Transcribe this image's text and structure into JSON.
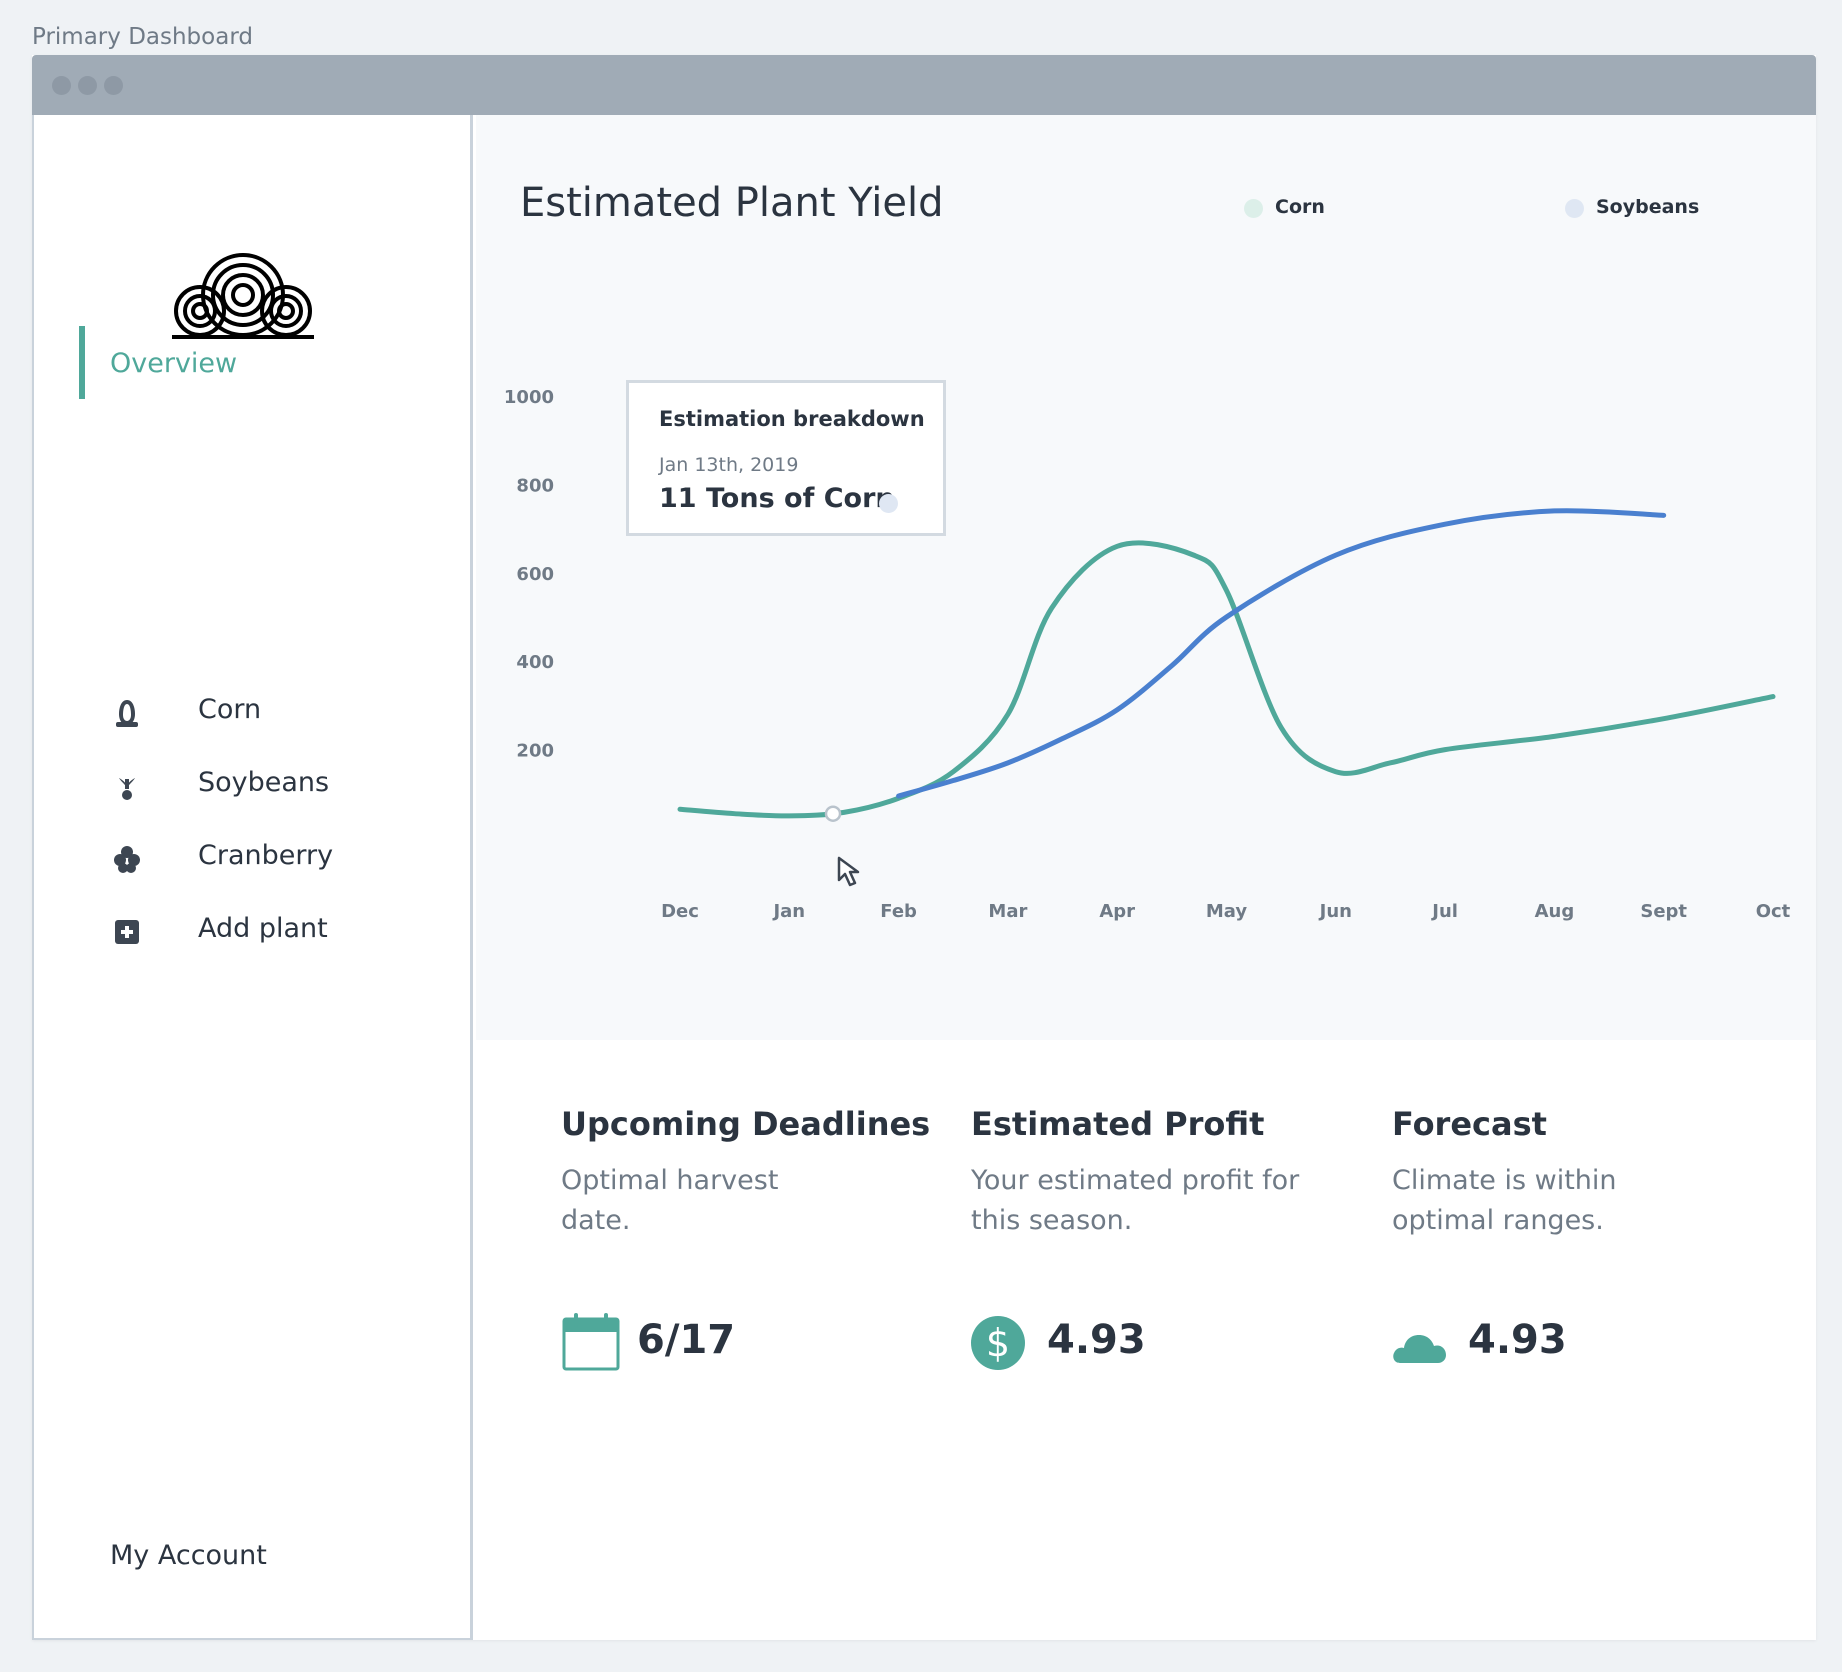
{
  "page_caption": "Primary Dashboard",
  "sidebar": {
    "logo": "swirl-cloud-logo",
    "overview": "Overview",
    "items": [
      {
        "label": "Corn",
        "icon": "corn-icon"
      },
      {
        "label": "Soybeans",
        "icon": "soybean-icon"
      },
      {
        "label": "Cranberry",
        "icon": "cranberry-icon"
      },
      {
        "label": "Add plant",
        "icon": "add-plant-icon"
      }
    ],
    "account": "My Account"
  },
  "colors": {
    "accent": "#4fa89a",
    "soy": "#4a80cf",
    "sidebar_border": "#c9d2db"
  },
  "chart_title": "Estimated Plant Yield",
  "legend": {
    "corn": "Corn",
    "soybeans": "Soybeans"
  },
  "tooltip": {
    "title": "Estimation breakdown",
    "date": "Jan 13th, 2019",
    "value": "11 Tons of Corn"
  },
  "chart_data": {
    "type": "line",
    "title": "Estimated Plant Yield",
    "categories": [
      "Dec",
      "Jan",
      "Feb",
      "Mar",
      "Apr",
      "May",
      "Jun",
      "Jul",
      "Aug",
      "Sept",
      "Oct"
    ],
    "y_ticks": [
      "1000",
      "800",
      "600",
      "400",
      "200"
    ],
    "ylim": [
      0,
      1000
    ],
    "grid": false,
    "legend_position": "top-right",
    "series": [
      {
        "name": "Corn",
        "color": "#4fa89a",
        "x": [
          0,
          0.5,
          1,
          1.5,
          2,
          2.5,
          3,
          3.4,
          4,
          4.7,
          5,
          5.5,
          6,
          6.5,
          7,
          8,
          9,
          10
        ],
        "values": [
          65,
          55,
          50,
          58,
          90,
          150,
          280,
          520,
          660,
          640,
          560,
          250,
          150,
          170,
          200,
          230,
          270,
          320
        ]
      },
      {
        "name": "Soybeans",
        "color": "#4a80cf",
        "x": [
          2,
          2.5,
          3,
          3.5,
          4,
          4.5,
          5,
          6,
          7,
          8,
          9
        ],
        "values": [
          95,
          130,
          170,
          225,
          290,
          390,
          500,
          640,
          710,
          740,
          730
        ]
      }
    ],
    "highlight": {
      "series": "Corn",
      "x": 1.4,
      "value": 55
    }
  },
  "cards": [
    {
      "title": "Upcoming Deadlines",
      "desc": "Optimal harvest date.",
      "value": "6/17",
      "icon": "calendar-icon"
    },
    {
      "title": "Estimated Profit",
      "desc": "Your estimated profit for this season.",
      "value": "4.93",
      "icon": "dollar-icon"
    },
    {
      "title": "Forecast",
      "desc": "Climate is within optimal ranges.",
      "value": "4.93",
      "icon": "cloud-icon"
    }
  ]
}
